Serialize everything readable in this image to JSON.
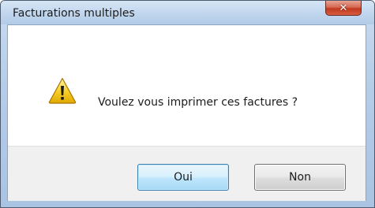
{
  "window": {
    "title": "Facturations multiples",
    "close_icon": "close-x-icon"
  },
  "dialog": {
    "icon": "warning-icon",
    "message": "Voulez vous imprimer ces factures ?"
  },
  "buttons": {
    "yes_label": "Oui",
    "no_label": "Non"
  },
  "colors": {
    "title_bar": "#c2d7ee",
    "close_button": "#c0391f",
    "button_bar": "#f0f0f0",
    "default_button_border": "#3c7fb1",
    "warning_yellow": "#f6c400"
  }
}
